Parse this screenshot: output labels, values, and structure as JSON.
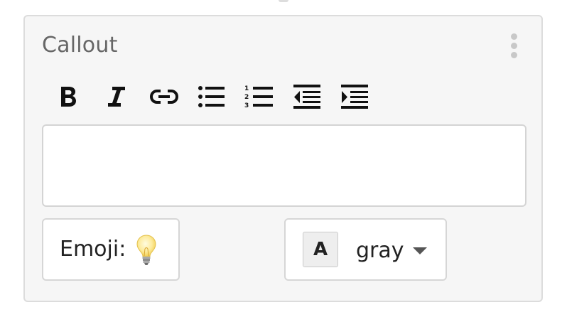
{
  "panel": {
    "title": "Callout"
  },
  "toolbar": {
    "buttons": [
      {
        "name": "bold",
        "icon": "bold-icon"
      },
      {
        "name": "italic",
        "icon": "italic-icon"
      },
      {
        "name": "link",
        "icon": "link-icon"
      },
      {
        "name": "bulleted-list",
        "icon": "bulleted-list-icon"
      },
      {
        "name": "numbered-list",
        "icon": "numbered-list-icon"
      },
      {
        "name": "outdent",
        "icon": "outdent-icon"
      },
      {
        "name": "indent",
        "icon": "indent-icon"
      }
    ]
  },
  "editor": {
    "value": ""
  },
  "emoji": {
    "label": "Emoji:",
    "value_icon": "light-bulb-icon"
  },
  "color": {
    "swatch_letter": "A",
    "selected": "gray"
  },
  "colors": {
    "panel_background": "#f6f6f6",
    "border": "#dcdcdc",
    "title_text": "#666666",
    "icon": "#111111",
    "dots": "#c8c8c8"
  }
}
